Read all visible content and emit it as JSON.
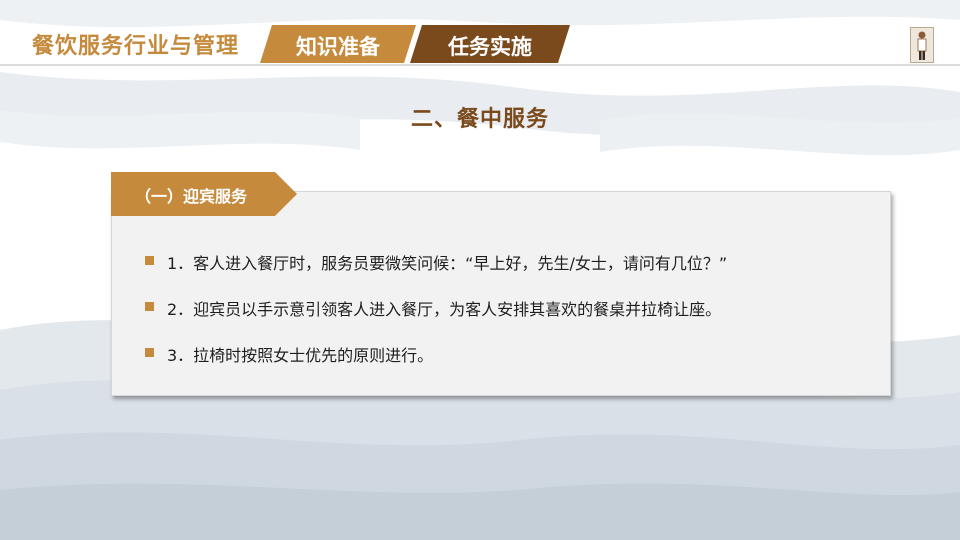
{
  "header": {
    "course_title": "餐饮服务行业与管理",
    "tabs": [
      {
        "label": "知识准备"
      },
      {
        "label": "任务实施"
      }
    ]
  },
  "section": {
    "title": "二、餐中服务"
  },
  "subsection": {
    "heading": "（一）迎宾服务",
    "items": [
      {
        "text": "1．客人进入餐厅时，服务员要微笑问候：“早上好，先生/女士，请问有几位？”"
      },
      {
        "text": "2．迎宾员以手示意引领客人进入餐厅，为客人安排其喜欢的餐桌并拉椅让座。"
      },
      {
        "text": "3．拉椅时按照女士优先的原则进行。"
      }
    ]
  },
  "colors": {
    "accent_orange": "#c58a3c",
    "accent_dark_brown": "#7a4a1d",
    "box_background": "#f2f2f2"
  }
}
